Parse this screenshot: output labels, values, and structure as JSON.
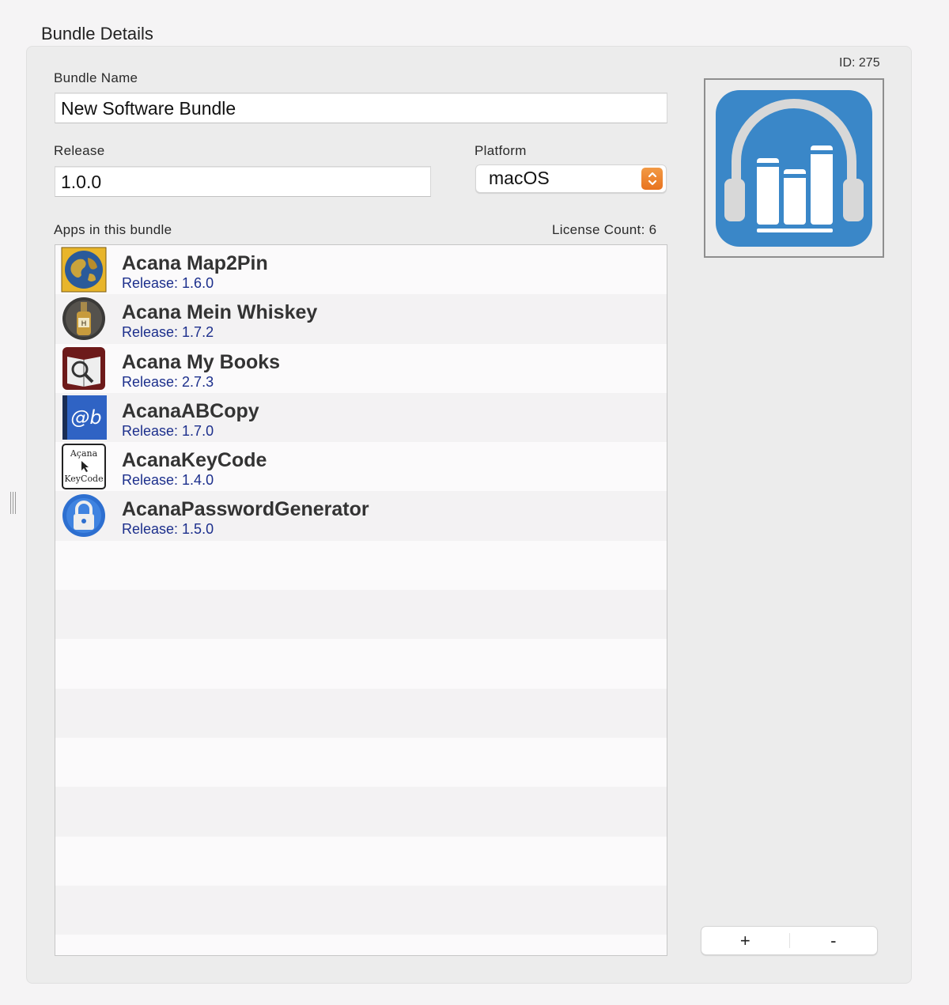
{
  "title": "Bundle Details",
  "id_label": "ID: 275",
  "bundle_name": {
    "label": "Bundle Name",
    "value": "New Software Bundle"
  },
  "release": {
    "label": "Release",
    "value": "1.0.0"
  },
  "platform": {
    "label": "Platform",
    "value": "macOS"
  },
  "apps": {
    "label": "Apps in this bundle",
    "license_count": "License Count: 6",
    "items": [
      {
        "name": "Acana Map2Pin",
        "release": "Release: 1.6.0",
        "icon": "globe-icon"
      },
      {
        "name": "Acana Mein Whiskey",
        "release": "Release: 1.7.2",
        "icon": "whiskey-bottle-icon"
      },
      {
        "name": "Acana My Books",
        "release": "Release: 2.7.3",
        "icon": "book-magnifier-icon"
      },
      {
        "name": "AcanaABCopy",
        "release": "Release: 1.7.0",
        "icon": "at-b-icon"
      },
      {
        "name": "AcanaKeyCode",
        "release": "Release: 1.4.0",
        "icon": "keycode-icon",
        "icon_text_top": "Açana",
        "icon_text_bottom": "KeyCode"
      },
      {
        "name": "AcanaPasswordGenerator",
        "release": "Release: 1.5.0",
        "icon": "padlock-icon"
      }
    ]
  },
  "buttons": {
    "add": "+",
    "remove": "-"
  },
  "colors": {
    "accent_orange": "#e8731f",
    "bundle_icon_blue": "#3a87c8",
    "release_blue": "#1c2f8c"
  }
}
